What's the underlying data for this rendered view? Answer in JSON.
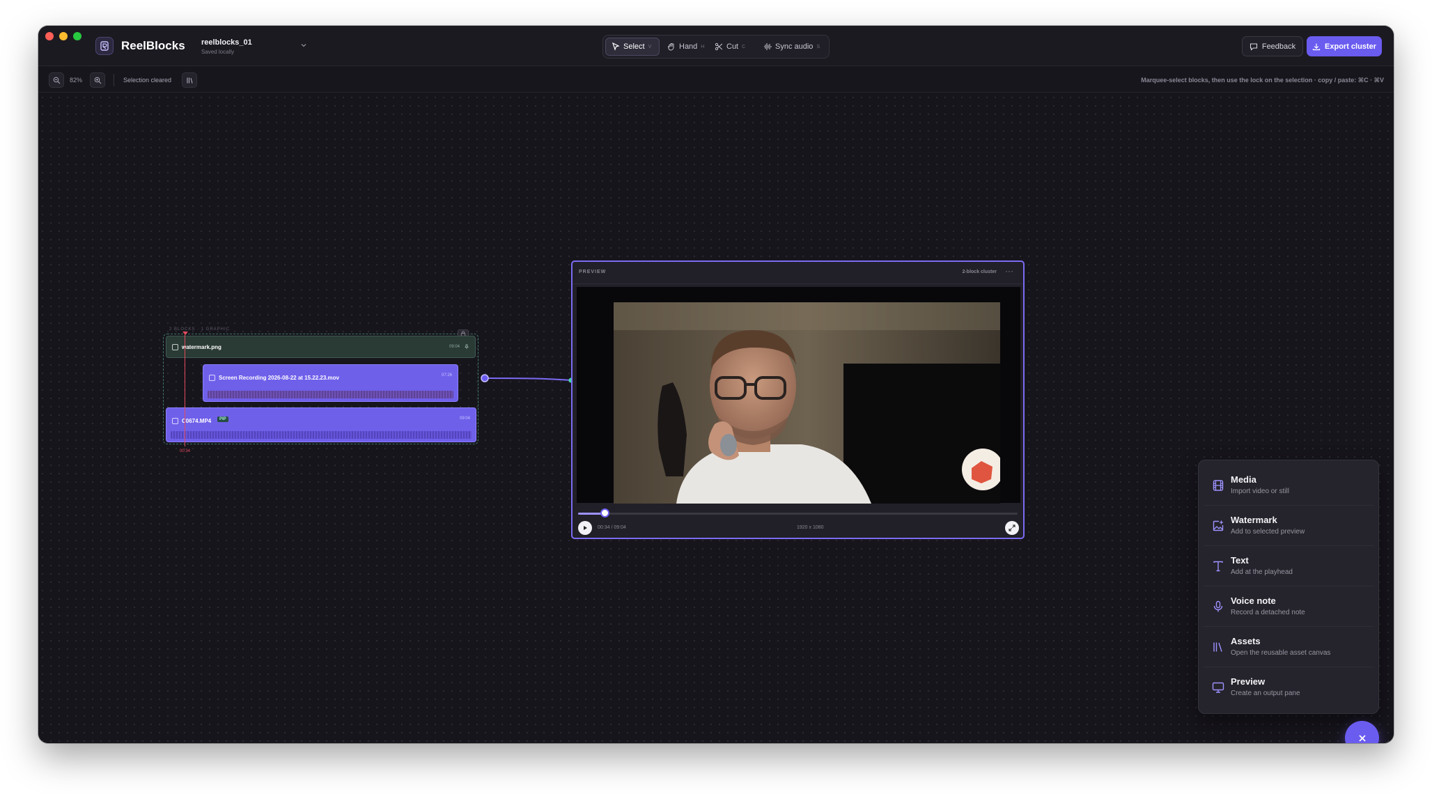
{
  "window": {
    "app_name": "ReelBlocks",
    "project": {
      "name": "reelblocks_01",
      "subtitle": "Saved locally"
    }
  },
  "toolbar": {
    "tools": [
      {
        "label": "Select",
        "key": "V",
        "icon": "cursor-icon",
        "active": true
      },
      {
        "label": "Hand",
        "key": "H",
        "icon": "hand-icon",
        "active": false
      },
      {
        "label": "Cut",
        "key": "C",
        "icon": "scissors-icon",
        "active": false
      },
      {
        "label": "Sync audio",
        "key": "S",
        "icon": "waveform-icon",
        "active": false
      }
    ],
    "feedback_label": "Feedback",
    "export_label": "Export cluster"
  },
  "statusbar": {
    "zoom": "82%",
    "status": "Selection cleared",
    "hint": "Marquee-select blocks, then use the lock on the selection · copy / paste: ⌘C · ⌘V"
  },
  "cluster": {
    "label": "2 BLOCKS · 1 GRAPHIC",
    "playhead_time": "00:34",
    "tracks": [
      {
        "name": "watermark.png",
        "duration": "09:04",
        "kind": "image"
      },
      {
        "name": "Screen Recording 2026-08-22 at 15.22.23.mov",
        "duration": "07:26",
        "kind": "video"
      },
      {
        "name": "C0674.MP4",
        "badge": "PIP",
        "duration": "09:04",
        "kind": "video"
      }
    ]
  },
  "preview": {
    "title": "PREVIEW",
    "meta": "2-block cluster",
    "time": "00:34 / 09:04",
    "resolution": "1920 x 1080",
    "progress": 0.06
  },
  "add_menu": {
    "items": [
      {
        "title": "Media",
        "desc": "Import video or still",
        "icon": "film-icon"
      },
      {
        "title": "Watermark",
        "desc": "Add to selected preview",
        "icon": "image-plus-icon"
      },
      {
        "title": "Text",
        "desc": "Add at the playhead",
        "icon": "text-icon"
      },
      {
        "title": "Voice note",
        "desc": "Record a detached note",
        "icon": "microphone-icon"
      },
      {
        "title": "Assets",
        "desc": "Open the reusable asset canvas",
        "icon": "library-icon"
      },
      {
        "title": "Preview",
        "desc": "Create an output pane",
        "icon": "monitor-icon"
      }
    ]
  },
  "colors": {
    "accent": "#6b5cf0",
    "background": "#17151c",
    "playhead": "#e24b5c"
  }
}
